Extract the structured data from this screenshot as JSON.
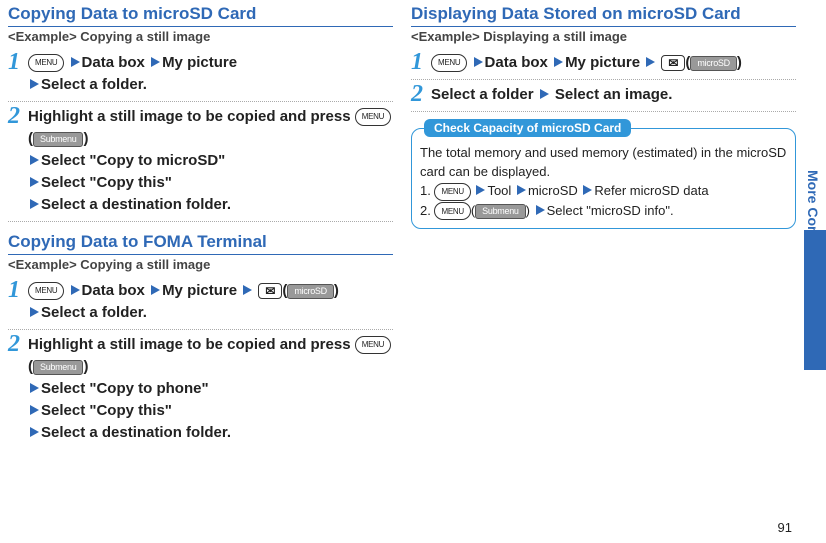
{
  "page_number": "91",
  "side_label": "More Convenient",
  "left": {
    "section1": {
      "title": "Copying Data to microSD Card",
      "example": "<Example> Copying a still image",
      "step1": {
        "databox": "Data box",
        "mypic": "My picture",
        "selfolder": "Select a folder."
      },
      "step2": {
        "l1": "Highlight a still image to be copied and press",
        "submenu": "Submenu",
        "s1": "Select \"Copy to microSD\"",
        "s2": "Select \"Copy this\"",
        "s3": "Select a destination folder."
      }
    },
    "section2": {
      "title": "Copying Data to FOMA Terminal",
      "example": "<Example> Copying a still image",
      "step1": {
        "databox": "Data box",
        "mypic": "My picture",
        "microsd": "microSD",
        "selfolder": "Select a folder."
      },
      "step2": {
        "l1": "Highlight a still image to be copied and press",
        "submenu": "Submenu",
        "s1": "Select \"Copy to phone\"",
        "s2": "Select \"Copy this\"",
        "s3": "Select a destination folder."
      }
    }
  },
  "right": {
    "section1": {
      "title": "Displaying Data Stored on microSD Card",
      "example": "<Example> Displaying a still image",
      "step1": {
        "databox": "Data box",
        "mypic": "My picture",
        "microsd": "microSD"
      },
      "step2": {
        "a": "Select a folder",
        "b": "Select an image."
      }
    },
    "info": {
      "tab": "Check Capacity of microSD Card",
      "line1": "The total memory and used memory (estimated) in the microSD card can be displayed.",
      "l1a": "Tool",
      "l1b": "microSD",
      "l1c": "Refer microSD data",
      "l2sub": "Submenu",
      "l2a": "Select \"microSD info\"."
    }
  },
  "labels": {
    "menu": "MENU"
  }
}
